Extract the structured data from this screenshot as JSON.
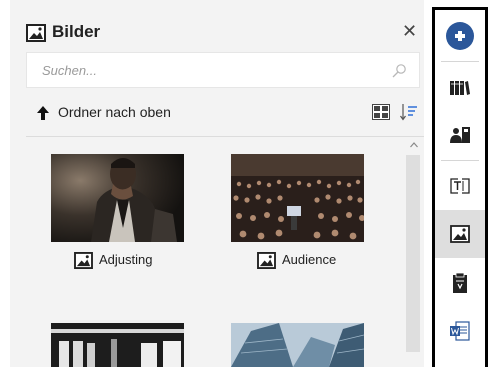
{
  "panel": {
    "title": "Bilder",
    "close_icon": "close-icon",
    "search": {
      "placeholder": "Suchen...",
      "value": ""
    },
    "up_folder_label": "Ordner nach oben"
  },
  "images": [
    {
      "label": "Adjusting"
    },
    {
      "label": "Audience"
    }
  ],
  "sidebar": {
    "icons": [
      "add-icon",
      "books-icon",
      "people-icon",
      "text-field-icon",
      "image-icon",
      "clipboard-icon",
      "word-document-icon"
    ],
    "selected": "image-icon"
  },
  "colors": {
    "accent": "#2b579a",
    "selected": "#dedede",
    "panel_bg": "#f3f3f3"
  }
}
